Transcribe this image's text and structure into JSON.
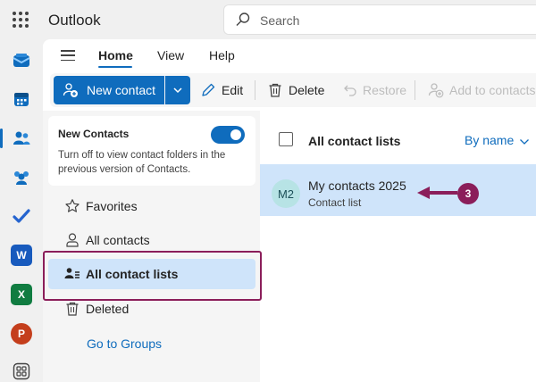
{
  "app": {
    "title": "Outlook"
  },
  "search": {
    "placeholder": "Search"
  },
  "rail": {
    "items": [
      {
        "name": "mail",
        "color": "#0f6cbd"
      },
      {
        "name": "calendar",
        "color": "#0f6cbd"
      },
      {
        "name": "people",
        "color": "#0f6cbd",
        "active": true
      },
      {
        "name": "groups",
        "color": "#0f6cbd"
      },
      {
        "name": "todo",
        "color": "#2564cf"
      },
      {
        "name": "word",
        "color": "#185abd",
        "letter": "W"
      },
      {
        "name": "excel",
        "color": "#107c41",
        "letter": "X"
      },
      {
        "name": "powerpoint",
        "color": "#c43e1c",
        "letter": "P"
      },
      {
        "name": "apps",
        "color": "#424242"
      }
    ]
  },
  "tabs": [
    {
      "label": "Home",
      "active": true
    },
    {
      "label": "View"
    },
    {
      "label": "Help"
    }
  ],
  "ribbon": {
    "new_contact": "New contact",
    "edit": "Edit",
    "delete": "Delete",
    "restore": "Restore",
    "add_to_contacts": "Add to contacts"
  },
  "nav": {
    "toggle": {
      "title": "New Contacts",
      "description": "Turn off to view contact folders in the previous version of Contacts.",
      "on": true
    },
    "items": [
      {
        "label": "Favorites",
        "icon": "star-icon"
      },
      {
        "label": "All contacts",
        "icon": "person-icon"
      },
      {
        "label": "All contact lists",
        "icon": "people-list-icon",
        "selected": true
      },
      {
        "label": "Deleted",
        "icon": "trash-icon"
      }
    ],
    "groups_link": "Go to Groups"
  },
  "list": {
    "title": "All contact lists",
    "sort": "By name",
    "rows": [
      {
        "initials": "M2",
        "title": "My contacts 2025",
        "subtitle": "Contact list"
      }
    ]
  },
  "annotation": {
    "badge": "3",
    "color": "#8b1e5a"
  },
  "colors": {
    "accent": "#0f6cbd",
    "selected_bg": "#cfe4fa"
  }
}
